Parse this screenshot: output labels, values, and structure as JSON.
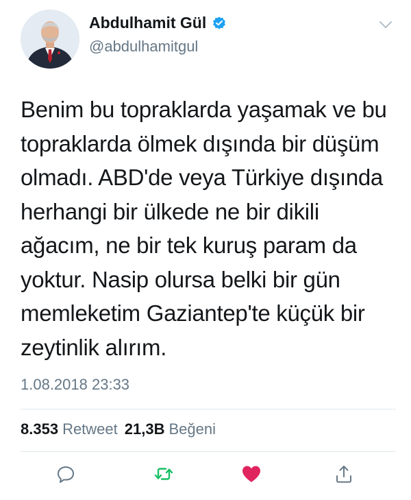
{
  "user": {
    "display_name": "Abdulhamit Gül",
    "handle": "@abdulhamitgul",
    "verified": true
  },
  "tweet": {
    "lines": [
      "Benim bu topraklarda yaşamak ve bu",
      "topraklarda ölmek dışında bir düşüm",
      "olmadı. ABD'de veya Türkiye dışında",
      "herhangi bir ülkede ne bir dikili",
      "ağacım, ne bir tek kuruş param da",
      "yoktur. Nasip olursa belki bir gün",
      "memleketim Gaziantep'te küçük bir",
      "zeytinlik alırım."
    ],
    "timestamp": "1.08.2018 23:33"
  },
  "stats": {
    "retweet_count": "8.353",
    "retweet_label": "Retweet",
    "like_count": "21,3B",
    "like_label": "Beğeni"
  },
  "actions": {
    "reply_icon": "reply-icon",
    "retweet_icon": "retweet-icon",
    "like_icon": "heart-icon",
    "share_icon": "share-icon"
  },
  "colors": {
    "verified_blue": "#1da1f2",
    "retweet_green": "#17bf63",
    "like_red": "#e0245e",
    "secondary_text": "#657786",
    "icon_gray": "#657786"
  }
}
